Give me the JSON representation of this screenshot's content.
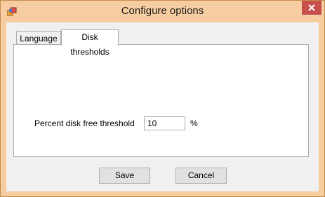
{
  "window": {
    "title": "Configure options",
    "close_glyph": "✕",
    "icon": "app-icon",
    "colors": {
      "frame": "#f6cda0",
      "close_button": "#c7504d",
      "client": "#f0f0f0"
    }
  },
  "tabs": [
    {
      "label": "Language",
      "selected": false
    },
    {
      "label": "Disk thresholds",
      "selected": true
    }
  ],
  "disk_thresholds": {
    "label": "Percent disk free threshold",
    "value": "10",
    "unit": "%"
  },
  "buttons": {
    "save": "Save",
    "cancel": "Cancel"
  }
}
